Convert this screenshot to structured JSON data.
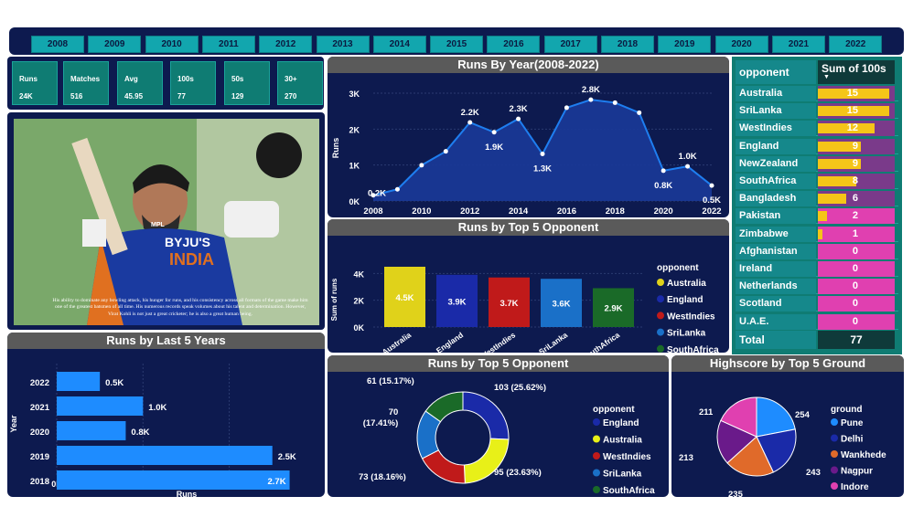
{
  "years": [
    "2008",
    "2009",
    "2010",
    "2011",
    "2012",
    "2013",
    "2014",
    "2015",
    "2016",
    "2017",
    "2018",
    "2019",
    "2020",
    "2021",
    "2022"
  ],
  "kpis": [
    {
      "label": "Runs",
      "value": "24K"
    },
    {
      "label": "Matches",
      "value": "516"
    },
    {
      "label": "Avg",
      "value": "45.95"
    },
    {
      "label": "100s",
      "value": "77"
    },
    {
      "label": "50s",
      "value": "129"
    },
    {
      "label": "30+",
      "value": "270"
    }
  ],
  "photo_caption": "His ability to dominate any bowling attack, his hunger for runs, and his consistency across all formats of the game make him one of the greatest batsmen of all time. His numerous records speak volumes about his talent and determination. However, Virat Kohli is not just a great cricketer; he is also a great human being.",
  "photo_jersey": {
    "sponsor": "BYJU'S",
    "team": "INDIA",
    "maker": "MPL"
  },
  "runs_by_year": {
    "title": "Runs By Year(2008-2022)",
    "xlabel": "Year",
    "ylabel": "Runs"
  },
  "top5_bar": {
    "title": "Runs by Top 5 Opponent",
    "ylabel": "Sum of runs",
    "legend_title": "opponent"
  },
  "last5": {
    "title": "Runs by Last 5 Years",
    "xlabel": "Runs",
    "ylabel": "Year"
  },
  "donut": {
    "title": "Runs by Top 5 Opponent",
    "legend_title": "opponent"
  },
  "pie": {
    "title": "Highscore by Top 5 Ground",
    "legend_title": "ground"
  },
  "table": {
    "col1": "opponent",
    "col2": "Sum of 100s",
    "rows": [
      {
        "name": "Australia",
        "value": "15"
      },
      {
        "name": "SriLanka",
        "value": "15"
      },
      {
        "name": "WestIndies",
        "value": "12"
      },
      {
        "name": "England",
        "value": "9"
      },
      {
        "name": "NewZealand",
        "value": "9"
      },
      {
        "name": "SouthAfrica",
        "value": "8"
      },
      {
        "name": "Bangladesh",
        "value": "6"
      },
      {
        "name": "Pakistan",
        "value": "2"
      },
      {
        "name": "Zimbabwe",
        "value": "1"
      },
      {
        "name": "Afghanistan",
        "value": "0"
      },
      {
        "name": "Ireland",
        "value": "0"
      },
      {
        "name": "Netherlands",
        "value": "0"
      },
      {
        "name": "Scotland",
        "value": "0"
      },
      {
        "name": "U.A.E.",
        "value": "0"
      }
    ],
    "total_label": "Total",
    "total_value": "77"
  },
  "chart_data": [
    {
      "type": "area",
      "title": "Runs By Year(2008-2022)",
      "xlabel": "Year",
      "ylabel": "Runs",
      "x": [
        2008,
        2009,
        2010,
        2011,
        2012,
        2013,
        2014,
        2015,
        2016,
        2017,
        2018,
        2019,
        2020,
        2021,
        2022
      ],
      "values": [
        159,
        325,
        995,
        1381,
        2186,
        1913,
        2286,
        1309,
        2595,
        2818,
        2735,
        2455,
        842,
        964,
        430
      ],
      "data_labels": {
        "2008": "0.2K",
        "2012": "2.2K",
        "2013": "1.9K",
        "2014": "2.3K",
        "2015": "1.3K",
        "2017": "2.8K",
        "2020": "0.8K",
        "2021": "1.0K",
        "2022": "0.5K"
      },
      "yticks": [
        "0K",
        "1K",
        "2K",
        "3K"
      ],
      "xticks": [
        "2008",
        "2010",
        "2012",
        "2014",
        "2016",
        "2018",
        "2020",
        "2022"
      ],
      "ylim": [
        0,
        3000
      ],
      "color": "#1e7ef0"
    },
    {
      "type": "bar",
      "title": "Runs by Top 5 Opponent",
      "ylabel": "Sum of runs",
      "categories": [
        "Australia",
        "England",
        "WestIndies",
        "SriLanka",
        "SouthAfrica"
      ],
      "values": [
        4500,
        3900,
        3700,
        3600,
        2900
      ],
      "data_labels": [
        "4.5K",
        "3.9K",
        "3.7K",
        "3.6K",
        "2.9K"
      ],
      "colors": [
        "#e0d21a",
        "#1a2aa8",
        "#c01a1a",
        "#1a70c8",
        "#1a6a28"
      ],
      "yticks": [
        "0K",
        "2K",
        "4K"
      ],
      "ylim": [
        0,
        4500
      ],
      "legend_title": "opponent"
    },
    {
      "type": "bar",
      "title": "Runs by Last 5 Years",
      "orientation": "horizontal",
      "xlabel": "Runs",
      "ylabel": "Year",
      "categories": [
        "2022",
        "2021",
        "2020",
        "2019",
        "2018"
      ],
      "values": [
        500,
        1000,
        800,
        2500,
        2700
      ],
      "data_labels": [
        "0.5K",
        "1.0K",
        "0.8K",
        "2.5K",
        "2.7K"
      ],
      "xticks": [
        "0K",
        "1K",
        "2K"
      ],
      "xlim": [
        0,
        2800
      ],
      "color": "#1e8cff"
    },
    {
      "type": "pie",
      "title": "Runs by Top 5 Opponent",
      "donut": true,
      "legend_title": "opponent",
      "slices": [
        {
          "name": "England",
          "value": 103,
          "label": "103 (25.62%)",
          "color": "#1a2aa8"
        },
        {
          "name": "Australia",
          "value": 95,
          "label": "95 (23.63%)",
          "color": "#e8f018"
        },
        {
          "name": "WestIndies",
          "value": 73,
          "label": "73 (18.16%)",
          "color": "#c01a1a"
        },
        {
          "name": "SriLanka",
          "value": 70,
          "label": "70 (17.41%)",
          "color": "#1a70c8"
        },
        {
          "name": "SouthAfrica",
          "value": 61,
          "label": "61 (15.17%)",
          "color": "#1a6a28"
        }
      ]
    },
    {
      "type": "pie",
      "title": "Highscore by Top 5 Ground",
      "legend_title": "ground",
      "slices": [
        {
          "name": "Pune",
          "value": 254,
          "label": "254",
          "color": "#1e8cff"
        },
        {
          "name": "Delhi",
          "value": 243,
          "label": "243",
          "color": "#1a2aa8"
        },
        {
          "name": "Wankhede",
          "value": 235,
          "label": "235",
          "color": "#e06a2a"
        },
        {
          "name": "Nagpur",
          "value": 213,
          "label": "213",
          "color": "#6a1a8a"
        },
        {
          "name": "Indore",
          "value": 211,
          "label": "211",
          "color": "#e040b0"
        }
      ]
    }
  ]
}
